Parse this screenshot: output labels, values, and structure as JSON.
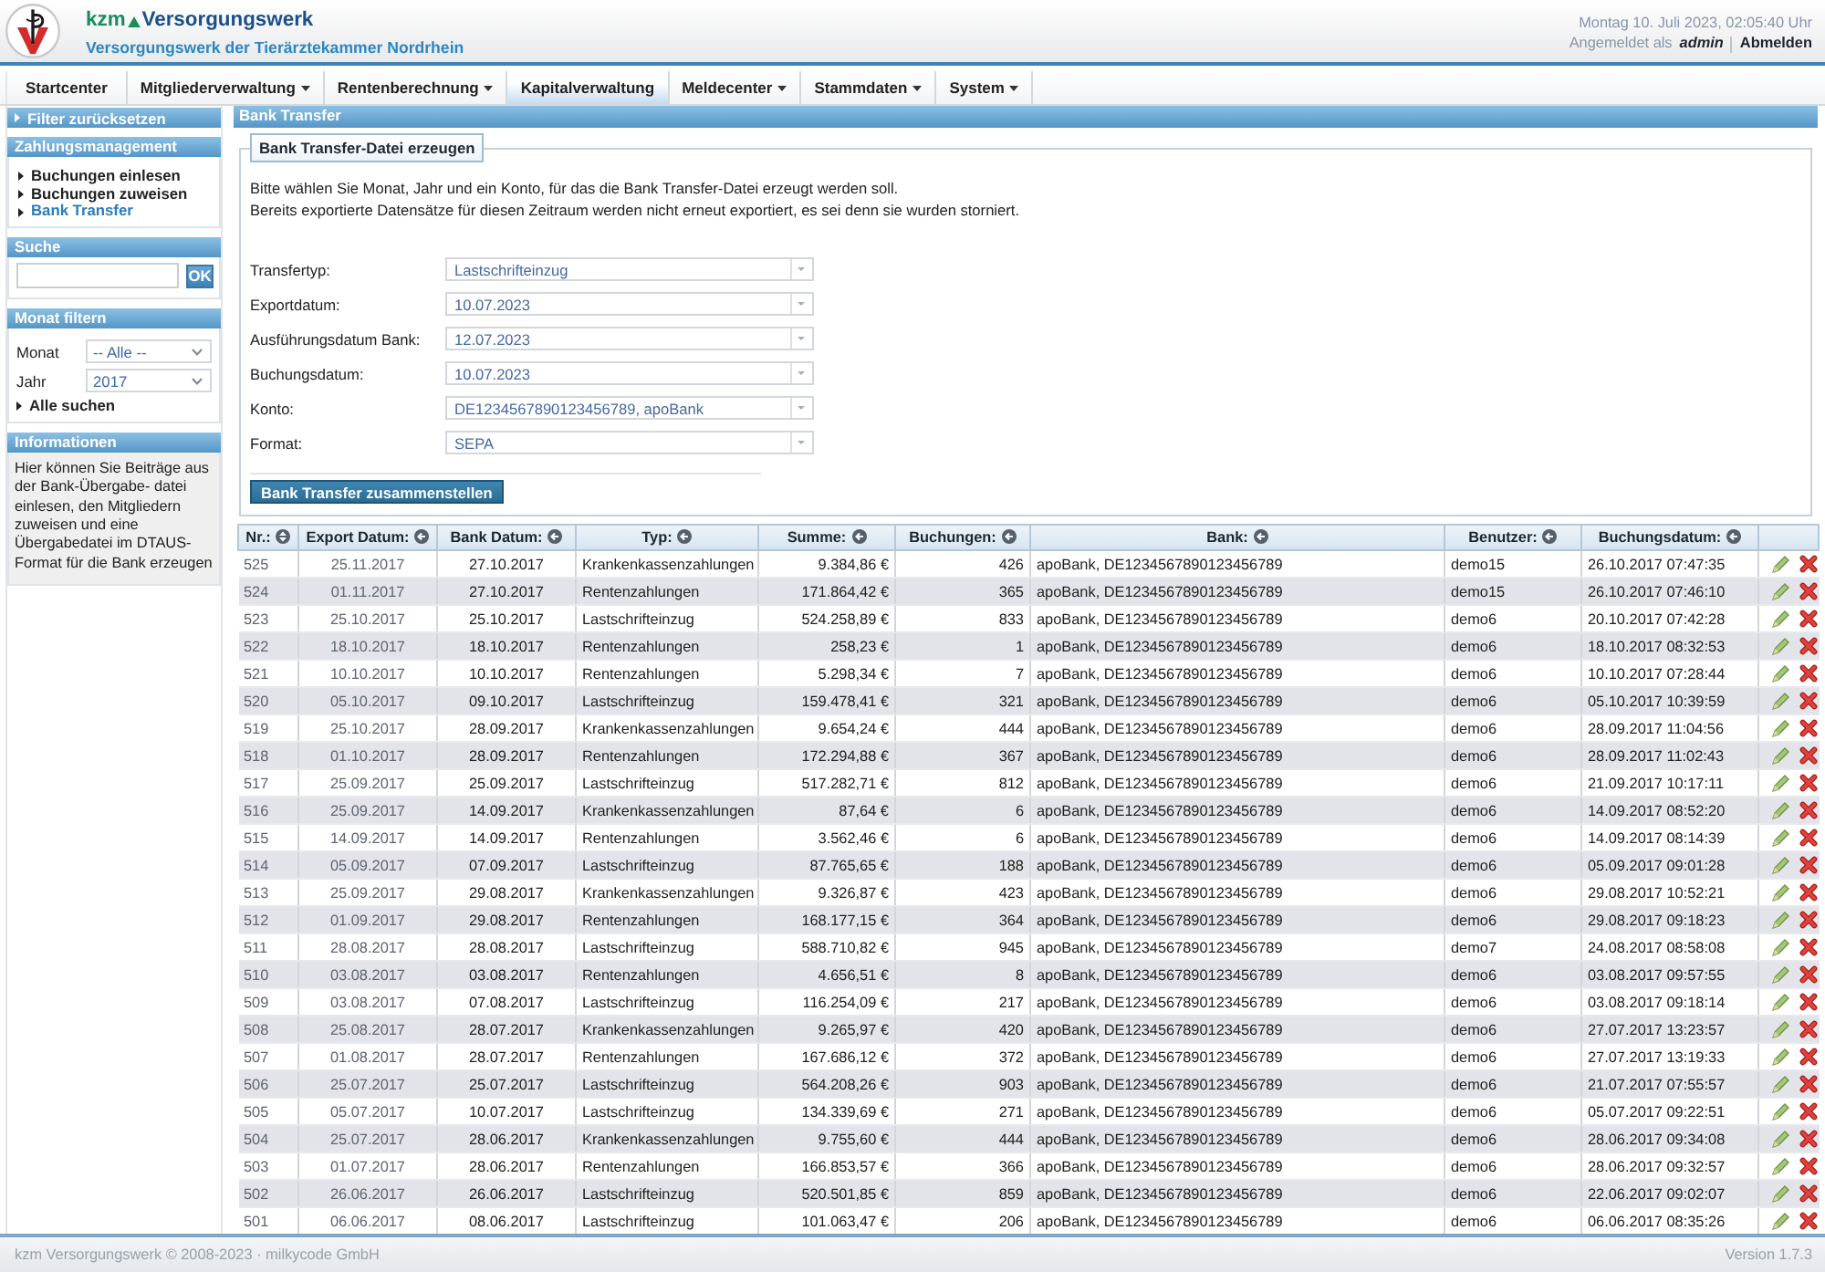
{
  "header": {
    "brand_prefix": "kzm",
    "brand_name": "Versorgungswerk",
    "subtitle": "Versorgungswerk der Tierärztekammer Nordrhein",
    "datetime": "Montag 10. Juli 2023, 02:05:40 Uhr",
    "login_label": "Angemeldet als",
    "user": "admin",
    "logout": "Abmelden"
  },
  "nav": {
    "tabs": [
      {
        "label": "Startcenter",
        "dropdown": false,
        "selected": false
      },
      {
        "label": "Mitgliederverwaltung",
        "dropdown": true,
        "selected": false
      },
      {
        "label": "Rentenberechnung",
        "dropdown": true,
        "selected": false
      },
      {
        "label": "Kapitalverwaltung",
        "dropdown": false,
        "selected": true
      },
      {
        "label": "Meldecenter",
        "dropdown": true,
        "selected": false
      },
      {
        "label": "Stammdaten",
        "dropdown": true,
        "selected": false
      },
      {
        "label": "System",
        "dropdown": true,
        "selected": false
      }
    ]
  },
  "sidebar": {
    "reset_filter": "Filter zurücksetzen",
    "sections": [
      {
        "kind": "links",
        "title": "Zahlungsmanagement",
        "items": [
          {
            "label": "Buchungen einlesen",
            "selected": false
          },
          {
            "label": "Buchungen zuweisen",
            "selected": false
          },
          {
            "label": "Bank Transfer",
            "selected": true
          }
        ]
      },
      {
        "kind": "search",
        "title": "Suche",
        "button": "OK"
      },
      {
        "kind": "filter",
        "title": "Monat filtern",
        "fields": [
          {
            "label": "Monat",
            "value": "-- Alle --"
          },
          {
            "label": "Jahr",
            "value": "2017"
          }
        ],
        "link": "Alle suchen"
      },
      {
        "kind": "info",
        "title": "Informationen",
        "text": "Hier können Sie Beiträge aus der Bank-Übergabe- datei einlesen, den Mitgliedern zuweisen und eine Übergabedatei im DTAUS-Format für die Bank erzeugen"
      }
    ]
  },
  "main": {
    "title": "Bank Transfer",
    "form": {
      "legend": "Bank Transfer-Datei erzeugen",
      "description": [
        "Bitte wählen Sie Monat, Jahr und ein Konto, für das die Bank Transfer-Datei erzeugt werden soll.",
        "Bereits exportierte Datensätze für diesen Zeitraum werden nicht erneut exportiert, es sei denn sie wurden storniert."
      ],
      "fields": [
        {
          "label": "Transfertyp:",
          "value": "Lastschrifteinzug"
        },
        {
          "label": "Exportdatum:",
          "value": "10.07.2023"
        },
        {
          "label": "Ausführungsdatum Bank:",
          "value": "12.07.2023"
        },
        {
          "label": "Buchungsdatum:",
          "value": "10.07.2023"
        },
        {
          "label": "Konto:",
          "value": "DE1234567890123456789, apoBank"
        },
        {
          "label": "Format:",
          "value": "SEPA"
        }
      ],
      "submit": "Bank Transfer zusammenstellen"
    },
    "table": {
      "columns": [
        {
          "label": "Nr.:",
          "sorted": true
        },
        {
          "label": "Export Datum:",
          "sorted": false
        },
        {
          "label": "Bank Datum:",
          "sorted": false
        },
        {
          "label": "Typ:",
          "sorted": false
        },
        {
          "label": "Summe:",
          "sorted": false
        },
        {
          "label": "Buchungen:",
          "sorted": false
        },
        {
          "label": "Bank:",
          "sorted": false
        },
        {
          "label": "Benutzer:",
          "sorted": false
        },
        {
          "label": "Buchungsdatum:",
          "sorted": false
        }
      ],
      "rows": [
        [
          "525",
          "25.11.2017",
          "27.10.2017",
          "Krankenkassenzahlungen",
          "9.384,86 €",
          "426",
          "apoBank, DE1234567890123456789",
          "demo15",
          "26.10.2017 07:47:35"
        ],
        [
          "524",
          "01.11.2017",
          "27.10.2017",
          "Rentenzahlungen",
          "171.864,42 €",
          "365",
          "apoBank, DE1234567890123456789",
          "demo15",
          "26.10.2017 07:46:10"
        ],
        [
          "523",
          "25.10.2017",
          "25.10.2017",
          "Lastschrifteinzug",
          "524.258,89 €",
          "833",
          "apoBank, DE1234567890123456789",
          "demo6",
          "20.10.2017 07:42:28"
        ],
        [
          "522",
          "18.10.2017",
          "18.10.2017",
          "Rentenzahlungen",
          "258,23 €",
          "1",
          "apoBank, DE1234567890123456789",
          "demo6",
          "18.10.2017 08:32:53"
        ],
        [
          "521",
          "10.10.2017",
          "10.10.2017",
          "Rentenzahlungen",
          "5.298,34 €",
          "7",
          "apoBank, DE1234567890123456789",
          "demo6",
          "10.10.2017 07:28:44"
        ],
        [
          "520",
          "05.10.2017",
          "09.10.2017",
          "Lastschrifteinzug",
          "159.478,41 €",
          "321",
          "apoBank, DE1234567890123456789",
          "demo6",
          "05.10.2017 10:39:59"
        ],
        [
          "519",
          "25.10.2017",
          "28.09.2017",
          "Krankenkassenzahlungen",
          "9.654,24 €",
          "444",
          "apoBank, DE1234567890123456789",
          "demo6",
          "28.09.2017 11:04:56"
        ],
        [
          "518",
          "01.10.2017",
          "28.09.2017",
          "Rentenzahlungen",
          "172.294,88 €",
          "367",
          "apoBank, DE1234567890123456789",
          "demo6",
          "28.09.2017 11:02:43"
        ],
        [
          "517",
          "25.09.2017",
          "25.09.2017",
          "Lastschrifteinzug",
          "517.282,71 €",
          "812",
          "apoBank, DE1234567890123456789",
          "demo6",
          "21.09.2017 10:17:11"
        ],
        [
          "516",
          "25.09.2017",
          "14.09.2017",
          "Krankenkassenzahlungen",
          "87,64 €",
          "6",
          "apoBank, DE1234567890123456789",
          "demo6",
          "14.09.2017 08:52:20"
        ],
        [
          "515",
          "14.09.2017",
          "14.09.2017",
          "Rentenzahlungen",
          "3.562,46 €",
          "6",
          "apoBank, DE1234567890123456789",
          "demo6",
          "14.09.2017 08:14:39"
        ],
        [
          "514",
          "05.09.2017",
          "07.09.2017",
          "Lastschrifteinzug",
          "87.765,65 €",
          "188",
          "apoBank, DE1234567890123456789",
          "demo6",
          "05.09.2017 09:01:28"
        ],
        [
          "513",
          "25.09.2017",
          "29.08.2017",
          "Krankenkassenzahlungen",
          "9.326,87 €",
          "423",
          "apoBank, DE1234567890123456789",
          "demo6",
          "29.08.2017 10:52:21"
        ],
        [
          "512",
          "01.09.2017",
          "29.08.2017",
          "Rentenzahlungen",
          "168.177,15 €",
          "364",
          "apoBank, DE1234567890123456789",
          "demo6",
          "29.08.2017 09:18:23"
        ],
        [
          "511",
          "28.08.2017",
          "28.08.2017",
          "Lastschrifteinzug",
          "588.710,82 €",
          "945",
          "apoBank, DE1234567890123456789",
          "demo7",
          "24.08.2017 08:58:08"
        ],
        [
          "510",
          "03.08.2017",
          "03.08.2017",
          "Rentenzahlungen",
          "4.656,51 €",
          "8",
          "apoBank, DE1234567890123456789",
          "demo6",
          "03.08.2017 09:57:55"
        ],
        [
          "509",
          "03.08.2017",
          "07.08.2017",
          "Lastschrifteinzug",
          "116.254,09 €",
          "217",
          "apoBank, DE1234567890123456789",
          "demo6",
          "03.08.2017 09:18:14"
        ],
        [
          "508",
          "25.08.2017",
          "28.07.2017",
          "Krankenkassenzahlungen",
          "9.265,97 €",
          "420",
          "apoBank, DE1234567890123456789",
          "demo6",
          "27.07.2017 13:23:57"
        ],
        [
          "507",
          "01.08.2017",
          "28.07.2017",
          "Rentenzahlungen",
          "167.686,12 €",
          "372",
          "apoBank, DE1234567890123456789",
          "demo6",
          "27.07.2017 13:19:33"
        ],
        [
          "506",
          "25.07.2017",
          "25.07.2017",
          "Lastschrifteinzug",
          "564.208,26 €",
          "903",
          "apoBank, DE1234567890123456789",
          "demo6",
          "21.07.2017 07:55:57"
        ],
        [
          "505",
          "05.07.2017",
          "10.07.2017",
          "Lastschrifteinzug",
          "134.339,69 €",
          "271",
          "apoBank, DE1234567890123456789",
          "demo6",
          "05.07.2017 09:22:51"
        ],
        [
          "504",
          "25.07.2017",
          "28.06.2017",
          "Krankenkassenzahlungen",
          "9.755,60 €",
          "444",
          "apoBank, DE1234567890123456789",
          "demo6",
          "28.06.2017 09:34:08"
        ],
        [
          "503",
          "01.07.2017",
          "28.06.2017",
          "Rentenzahlungen",
          "166.853,57 €",
          "366",
          "apoBank, DE1234567890123456789",
          "demo6",
          "28.06.2017 09:32:57"
        ],
        [
          "502",
          "26.06.2017",
          "26.06.2017",
          "Lastschrifteinzug",
          "520.501,85 €",
          "859",
          "apoBank, DE1234567890123456789",
          "demo6",
          "22.06.2017 09:02:07"
        ],
        [
          "501",
          "06.06.2017",
          "08.06.2017",
          "Lastschrifteinzug",
          "101.063,47 €",
          "206",
          "apoBank, DE1234567890123456789",
          "demo6",
          "06.06.2017 08:35:26"
        ]
      ]
    }
  },
  "footer": {
    "copyright": "kzm Versorgungswerk © 2008-2023 · milkycode GmbH",
    "version": "Version 1.7.3"
  }
}
